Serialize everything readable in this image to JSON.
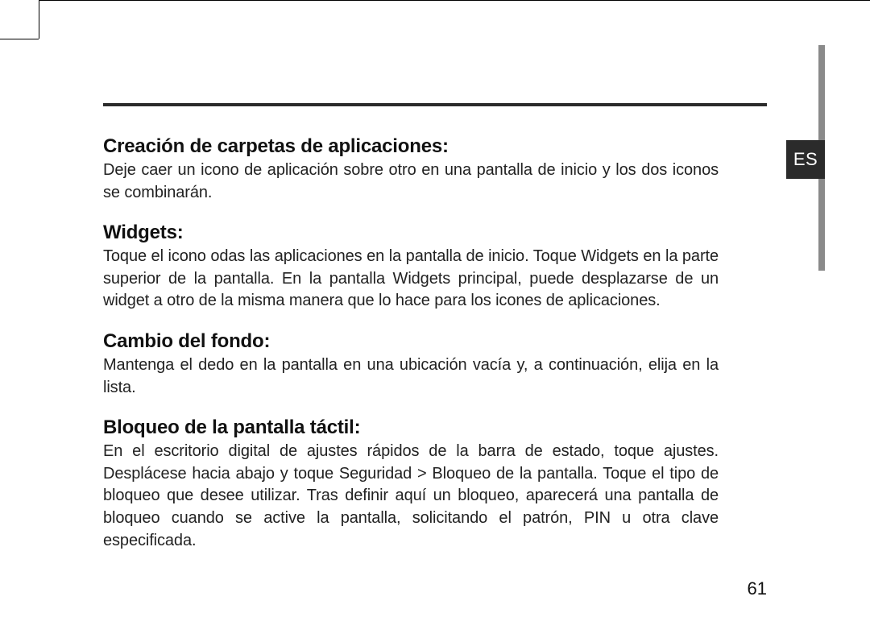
{
  "language_tab": "ES",
  "page_number": "61",
  "sections": [
    {
      "heading": "Creación de carpetas de aplicaciones:",
      "body": "Deje caer un icono de aplicación sobre otro en una pantalla de inicio y los dos iconos se combinarán."
    },
    {
      "heading": "Widgets:",
      "body": "Toque el icono odas las aplicaciones en la pantalla de inicio. Toque Widgets en la parte superior de la pantalla. En la pantalla Widgets principal, puede desplazarse de un widget a otro de la misma manera que lo hace para los icones de aplicaciones."
    },
    {
      "heading": "Cambio del fondo:",
      "body": "Mantenga el dedo en la pantalla en una ubicación vacía y, a continuación, elija en la lista."
    },
    {
      "heading": "Bloqueo de la pantalla táctil:",
      "body": "En el escritorio digital de ajustes rápidos de la barra de estado, toque ajustes. Desplácese hacia abajo y toque Seguridad > Bloqueo de la pantalla. Toque el tipo de bloqueo que desee utilizar. Tras definir aquí un bloqueo, aparecerá una pantalla de bloqueo cuando se active la pantalla, solicitando el patrón, PIN u otra clave especificada."
    }
  ]
}
